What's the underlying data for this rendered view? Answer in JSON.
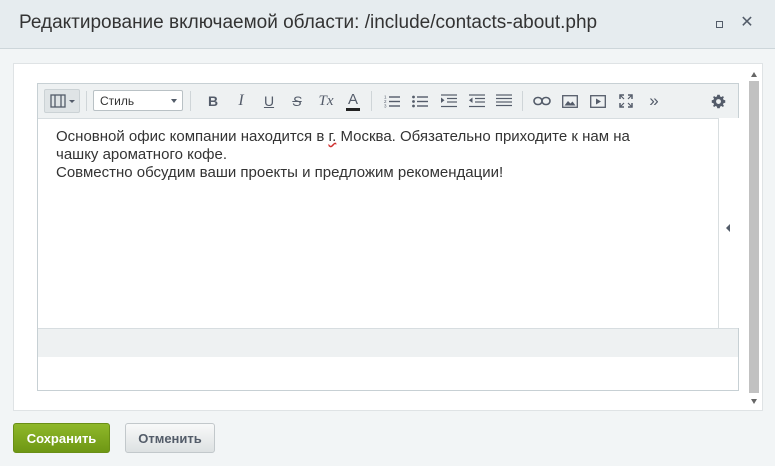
{
  "dialog": {
    "title": "Редактирование включаемой области: /include/contacts-about.php"
  },
  "editor": {
    "style_select_value": "Стиль",
    "content": {
      "line1_a": "Основной офис компании находится в ",
      "line1_b": "г.",
      "line1_c": " Москва. Обязательно приходите к нам на",
      "line2": "чашку ароматного кофе.",
      "line3": "Совместно обсудим ваши проекты и предложим рекомендации!"
    },
    "toolbar_icons": {
      "bold": "B",
      "italic": "I",
      "underline": "U",
      "strike": "S",
      "remove_format": "Tx",
      "font_color": "A",
      "more": "»"
    }
  },
  "buttons": {
    "save": "Сохранить",
    "cancel": "Отменить"
  }
}
